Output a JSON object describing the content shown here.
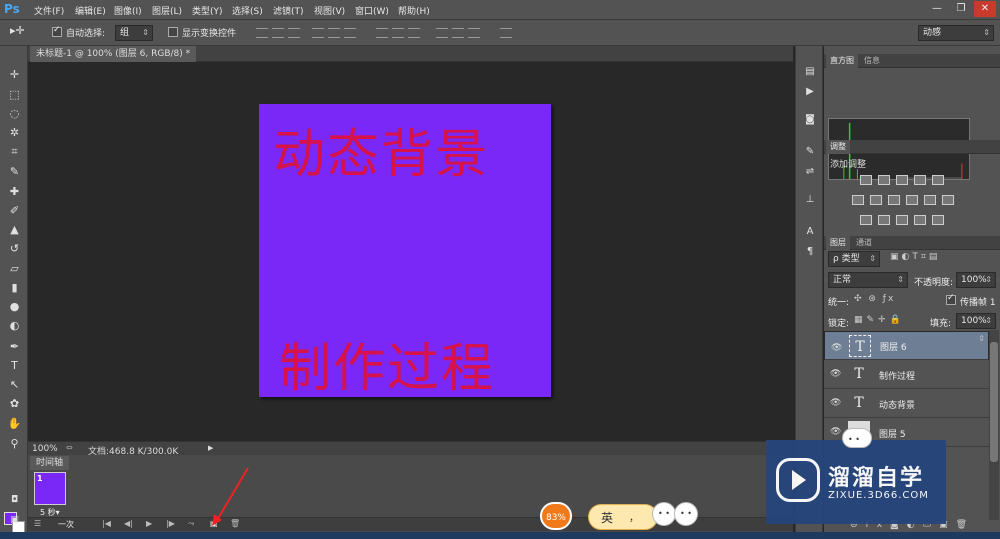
{
  "app": {
    "logo": "Ps"
  },
  "menu": [
    "文件(F)",
    "编辑(E)",
    "图像(I)",
    "图层(L)",
    "类型(Y)",
    "选择(S)",
    "滤镜(T)",
    "视图(V)",
    "窗口(W)",
    "帮助(H)"
  ],
  "window_controls": {
    "minimize": "—",
    "restore": "❐",
    "close": "✕"
  },
  "options": {
    "auto_select_label": "自动选择:",
    "auto_select_value": "组",
    "show_transform_label": "显示变换控件",
    "workspace": "动感"
  },
  "document": {
    "tab": "未标题-1 @ 100% (图层 6, RGB/8) *",
    "canvas_color": "#7a28f7",
    "text_color": "#d5124a",
    "text_top": "动态背景",
    "text_bottom": "制作过程"
  },
  "status": {
    "zoom": "100%",
    "doc_info": "文档:468.8 K/300.0K"
  },
  "timeline": {
    "tab": "时间轴",
    "frame_number": "1",
    "frame_time": "5 秒▾",
    "loop": "一次"
  },
  "panels": {
    "histogram_tab": "直方图",
    "info_tab": "信息",
    "adjust_tab": "调整",
    "add_adjust": "添加调整",
    "layers_tab": "图层",
    "channels_tab": "通道",
    "filter_kind": "ρ 类型",
    "blend_mode": "正常",
    "opacity_label": "不透明度:",
    "opacity_value": "100%",
    "unify_label": "统一:",
    "propagate_label": "传播帧 1",
    "lock_label": "锁定:",
    "fill_label": "填充:",
    "fill_value": "100%"
  },
  "layers": [
    {
      "name": "图层 6",
      "thumb": "T",
      "selected": true
    },
    {
      "name": "制作过程",
      "thumb": "T",
      "selected": false
    },
    {
      "name": "动态背景",
      "thumb": "T",
      "selected": false
    },
    {
      "name": "图层 5",
      "thumb": "",
      "selected": false
    }
  ],
  "watermark": {
    "title": "溜溜自学",
    "subtitle": "ZIXUE.3D66.COM"
  },
  "ime": {
    "percent": "83%",
    "lang": "英",
    "punct": "，"
  }
}
